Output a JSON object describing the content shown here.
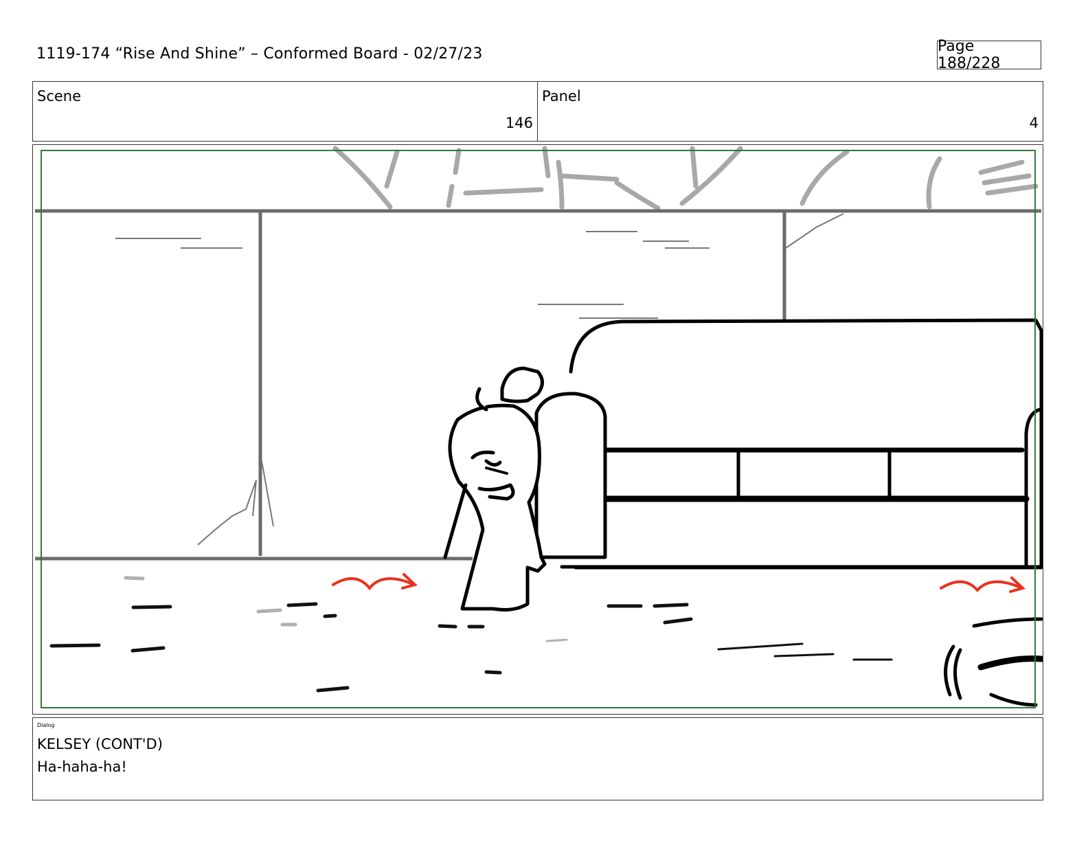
{
  "header": {
    "title": "1119-174 “Rise And Shine” – Conformed Board - 02/27/23",
    "page": "Page 188/228"
  },
  "info": {
    "scene_label": "Scene",
    "scene_value": "146",
    "panel_label": "Panel",
    "panel_value": "4"
  },
  "dialog": {
    "label": "Dialog",
    "speaker": "KELSEY (CONT'D)",
    "line": "Ha-haha-ha!"
  },
  "colors": {
    "safe_area": "#2e7d32",
    "motion_arrow": "#e8321e",
    "rough_lines": "#9e9e9e"
  }
}
